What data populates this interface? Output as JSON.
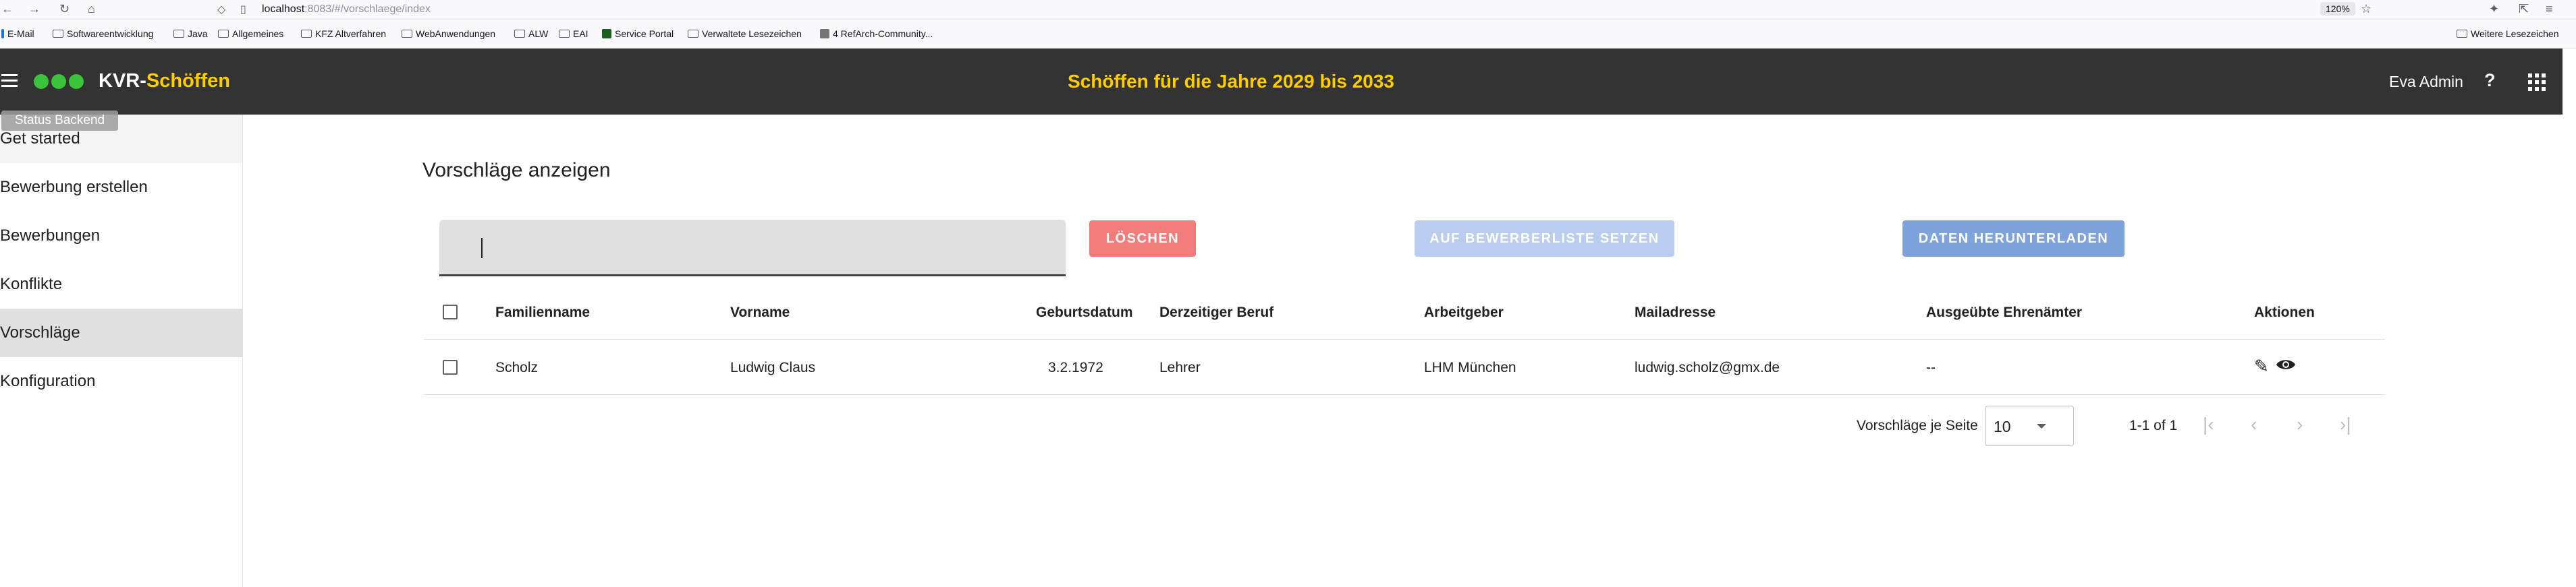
{
  "browser": {
    "url_host": "localhost",
    "url_rest": ":8083/#/vorschlaege/index",
    "zoom": "120%"
  },
  "bookmarks": [
    {
      "label": "E-Mail",
      "icon": "mail-icon"
    },
    {
      "label": "Softwareentwicklung",
      "icon": "folder-icon"
    },
    {
      "label": "Java",
      "icon": "folder-icon"
    },
    {
      "label": "Allgemeines",
      "icon": "folder-icon"
    },
    {
      "label": "KFZ Altverfahren",
      "icon": "folder-icon"
    },
    {
      "label": "WebAnwendungen",
      "icon": "folder-icon"
    },
    {
      "label": "ALW",
      "icon": "folder-icon"
    },
    {
      "label": "EAI",
      "icon": "folder-icon"
    },
    {
      "label": "Service Portal",
      "icon": "service-portal-icon"
    },
    {
      "label": "Verwaltete Lesezeichen",
      "icon": "folder-icon"
    },
    {
      "label": "4 RefArch-Community...",
      "icon": "refarch-icon"
    }
  ],
  "bookmarks_right": "Weitere Lesezeichen",
  "header": {
    "brand_left": "KVR-",
    "brand_right": "Schöffen",
    "title": "Schöffen für die Jahre 2029 bis 2033",
    "user": "Eva Admin",
    "help": "?",
    "dot_color": "#3cc33c",
    "accent_color": "#ffcc00",
    "bar_color": "#333333"
  },
  "status_tooltip": "Status Backend",
  "sidebar": {
    "items": [
      {
        "label": "Get started"
      },
      {
        "label": "Bewerbung erstellen"
      },
      {
        "label": "Bewerbungen"
      },
      {
        "label": "Konflikte"
      },
      {
        "label": "Vorschläge",
        "active": true
      },
      {
        "label": "Konfiguration"
      }
    ]
  },
  "main": {
    "title": "Vorschläge anzeigen",
    "search_value": "",
    "buttons": {
      "delete": "LÖSCHEN",
      "set_list": "AUF BEWERBERLISTE SETZEN",
      "download": "DATEN HERUNTERLADEN"
    },
    "table": {
      "headers": [
        "Familienname",
        "Vorname",
        "Geburtsdatum",
        "Derzeitiger Beruf",
        "Arbeitgeber",
        "Mailadresse",
        "Ausgeübte Ehrenämter",
        "Aktionen"
      ],
      "rows": [
        {
          "familienname": "Scholz",
          "vorname": "Ludwig Claus",
          "geburtsdatum": "3.2.1972",
          "beruf": "Lehrer",
          "arbeitgeber": "LHM München",
          "mail": "ludwig.scholz@gmx.de",
          "ehrenaemter": "--"
        }
      ]
    },
    "pagination": {
      "per_page_label": "Vorschläge je Seite",
      "per_page_value": "10",
      "range": "1-1 of 1"
    }
  }
}
